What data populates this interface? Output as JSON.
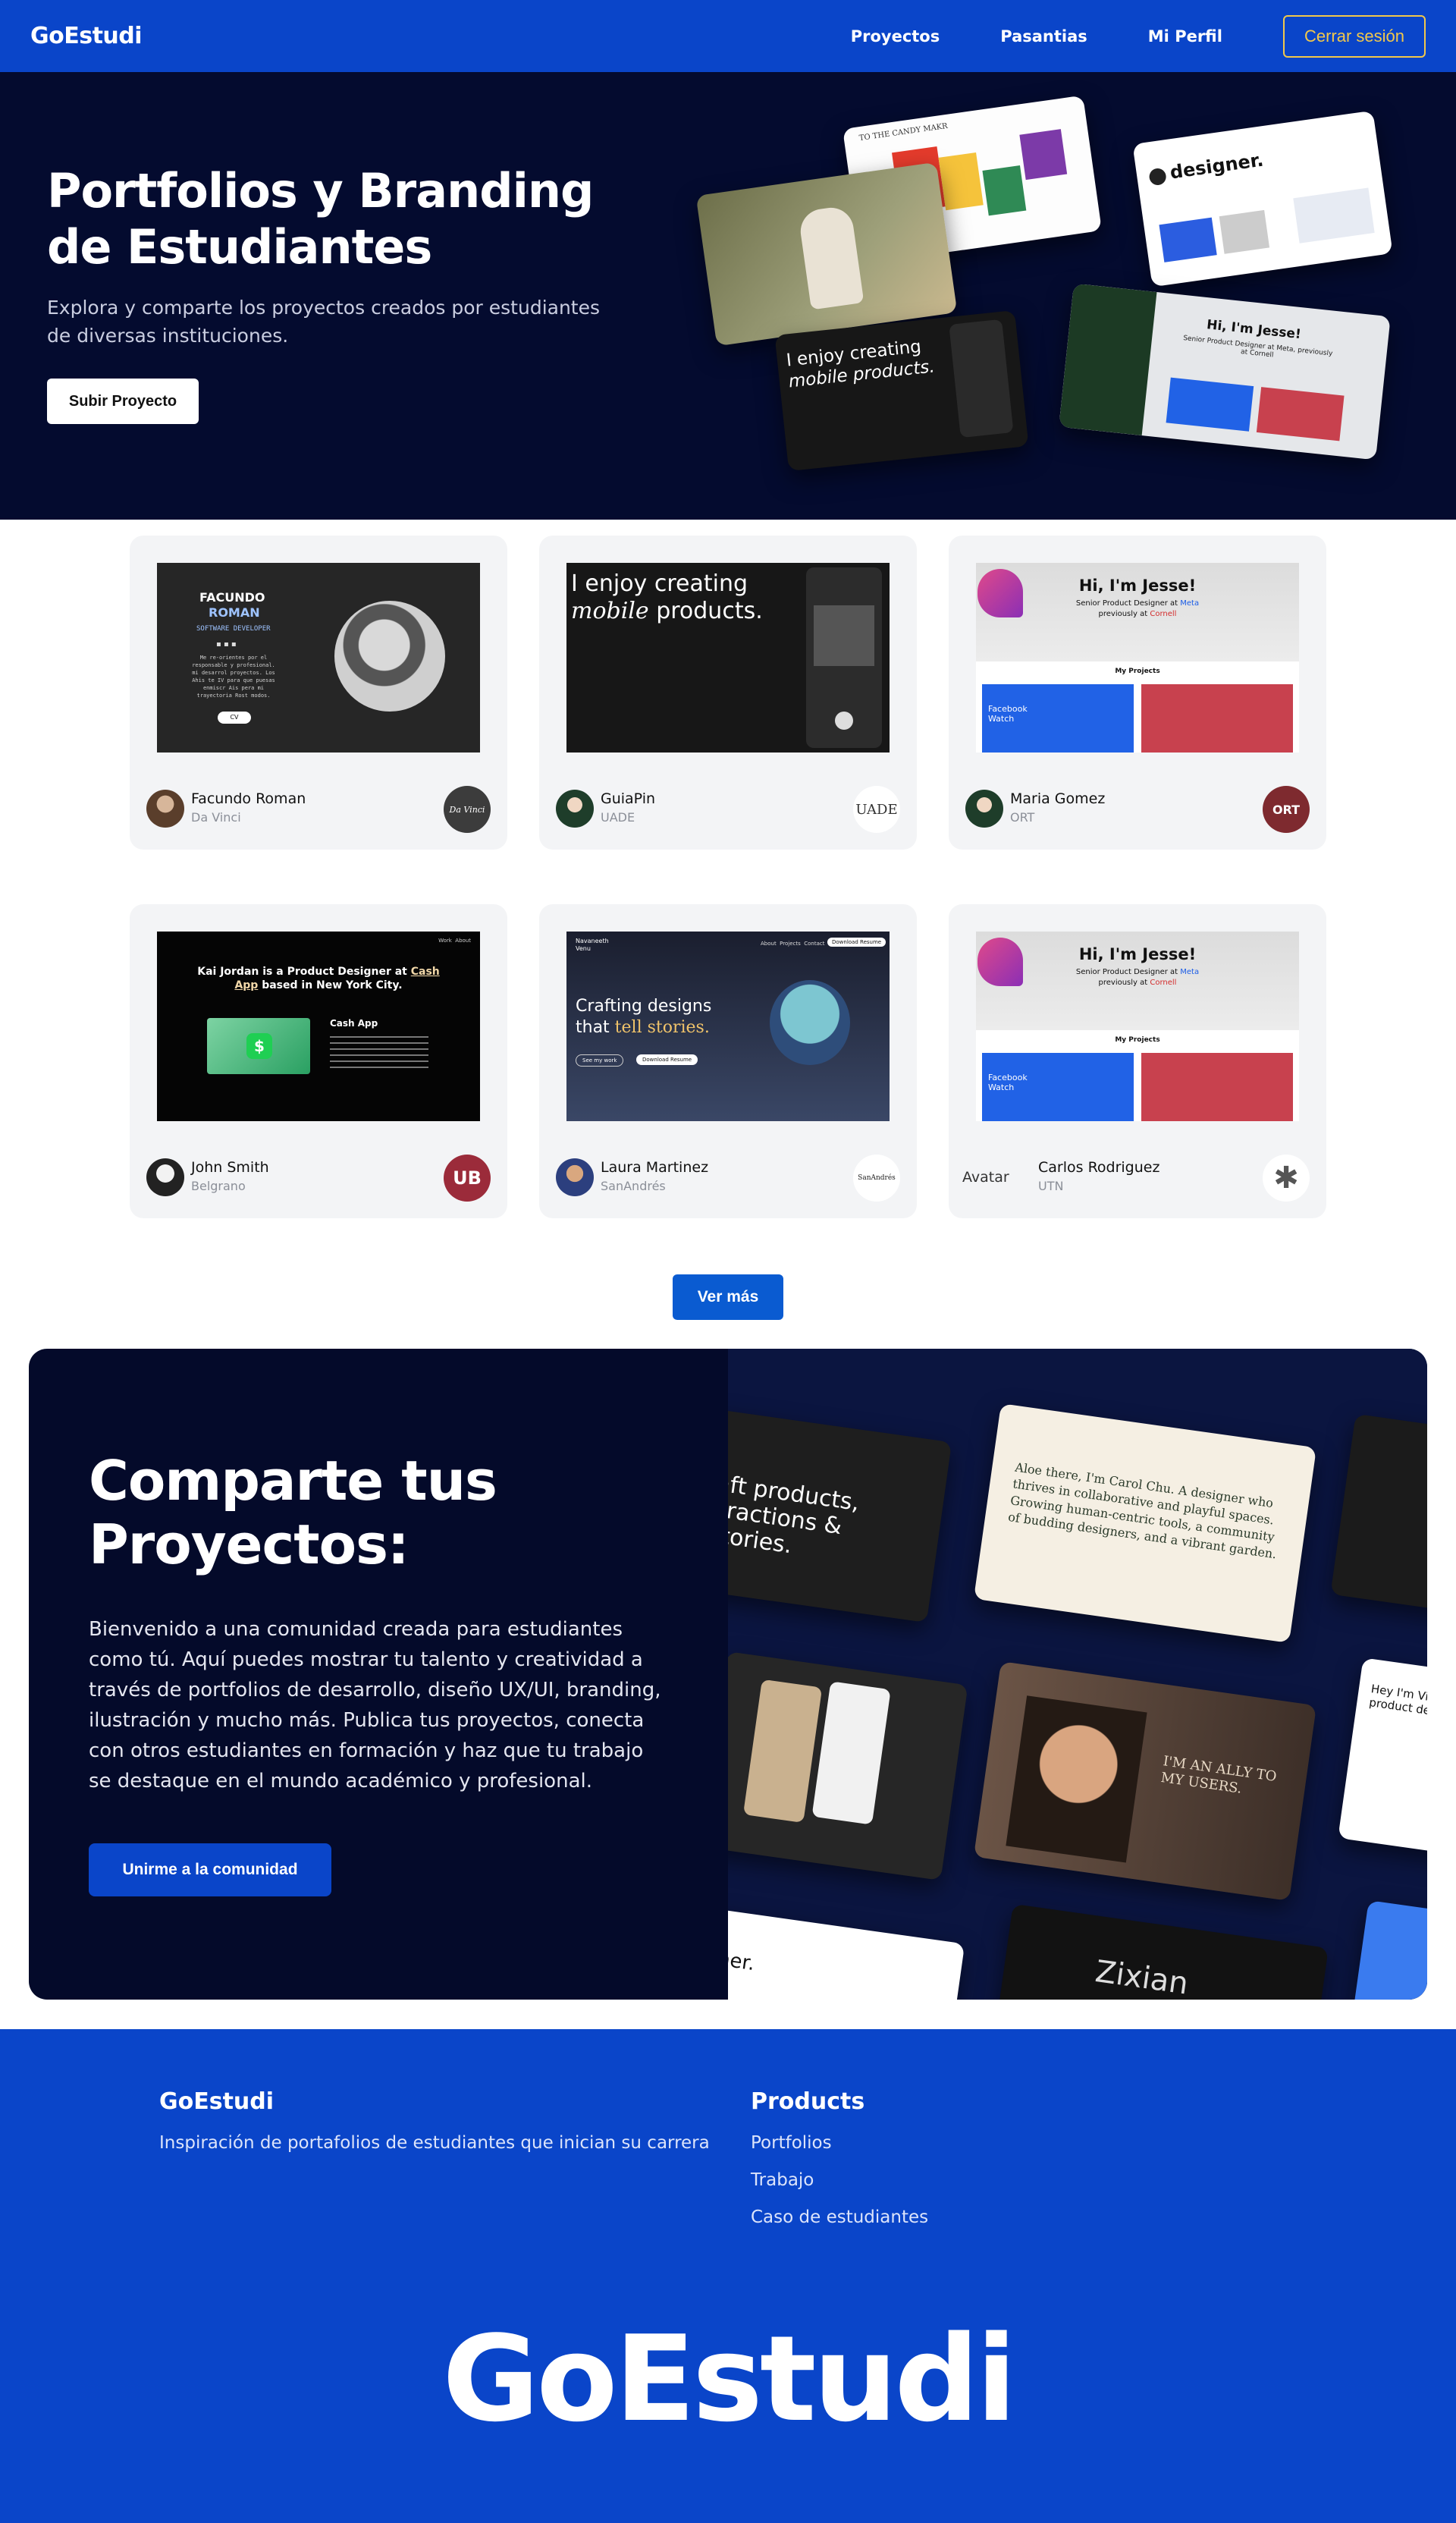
{
  "nav": {
    "brand": "GoEstudi",
    "links": [
      "Proyectos",
      "Pasantias",
      "Mi Perfil"
    ],
    "logout_label": "Cerrar sesión"
  },
  "hero": {
    "title": "Portfolios y Branding de Estudiantes",
    "subtitle": "Explora y comparte los proyectos creados por estudiantes de diversas instituciones.",
    "upload_label": "Subir Proyecto",
    "collage": {
      "candy_title": "TO THE CANDY MAKR",
      "designer": "designer.",
      "mobile_line1": "I enjoy creating",
      "mobile_line2": "mobile products.",
      "jesse_title": "Hi, I'm Jesse!",
      "jesse_role": "Senior Product Designer at Meta, previously at Cornell"
    }
  },
  "projects": [
    {
      "name": "Facundo Roman",
      "institution": "Da Vinci",
      "logo_text": "Da Vinci",
      "thumb": {
        "title_line1": "FACUNDO",
        "title_line2": "ROMAN",
        "role": "SOFTWARE DEVELOPER",
        "desc": "Me re-orientes por el responsable y profesional. mi desarrol proyectos. Los Ahis te IV para que puesas enmiscr Ais pera mi trayectoria Rost modos.",
        "cv": "CV"
      }
    },
    {
      "name": "GuiaPin",
      "institution": "UADE",
      "logo_text": "UADE",
      "thumb": {
        "line1": "I enjoy creating",
        "line2_italic": "mobile",
        "line2_rest": " products."
      }
    },
    {
      "name": "Maria Gomez",
      "institution": "ORT",
      "logo_text": "ORT",
      "thumb": {
        "title": "Hi, I'm Jesse!",
        "role_prefix": "Senior Product Designer at ",
        "role_company": "Meta",
        "previously": "previously at ",
        "prev_company": "Cornell",
        "projects_label": "My Projects",
        "watch_label": "Facebook Watch"
      }
    },
    {
      "name": "John Smith",
      "institution": "Belgrano",
      "logo_text": "UB",
      "thumb": {
        "headline_a": "Kai Jordan is a Product Designer at ",
        "headline_link": "Cash App",
        "headline_b": " based in New York City.",
        "project": "Cash App",
        "nav1": "Work",
        "nav2": "About"
      }
    },
    {
      "name": "Laura Martinez",
      "institution": "SanAndrés",
      "logo_text": "SanAndrés",
      "thumb": {
        "brand_line1": "Navaneeth",
        "brand_line2": "Venu",
        "menu": [
          "About",
          "Projects",
          "Contact"
        ],
        "resume_btn": "Download Resume",
        "headline_a": "Crafting designs",
        "headline_b": "that ",
        "headline_em": "tell stories.",
        "see_work": "See my work",
        "download": "Download Resume"
      }
    },
    {
      "name": "Carlos Rodriguez",
      "institution": "UTN",
      "logo_text": "✱",
      "avatar_alt": "Avatar",
      "thumb": {
        "title": "Hi, I'm Jesse!",
        "role_prefix": "Senior Product Designer at ",
        "role_company": "Meta",
        "previously": "previously at ",
        "prev_company": "Cornell",
        "projects_label": "My Projects",
        "watch_label": "Facebook Watch"
      }
    }
  ],
  "more_label": "Ver más",
  "community": {
    "title": "Comparte tus Proyectos:",
    "body": "Bienvenido a una comunidad creada para estudiantes como tú. Aquí puedes mostrar tu talento y creatividad a través de portfolios de desarrollo, diseño UX/UI, branding, ilustración y mucho más. Publica tus proyectos, conecta con otros estudiantes en formación y haz que tu trabajo se destaque en el mundo académico y profesional.",
    "join_label": "Unirme a la comunidad",
    "gallery": {
      "craft": "aft products, eractions & stories.",
      "carol": "Aloe there, I'm Carol Chu. A designer who thrives in collaborative and playful spaces. Growing human-centric tools, a community of budding designers, and a vibrant garden.",
      "victor": "Hey I'm Victor, a product designer",
      "ally": "I'M AN ALLY TO MY USERS.",
      "zixian": "Zixian",
      "partial": "ner."
    }
  },
  "footer": {
    "brand": "GoEstudi",
    "tagline": "Inspiración de portafolios de estudiantes que inician su carrera",
    "products_title": "Products",
    "products": [
      "Portfolios",
      "Trabajo",
      "Caso de estudiantes"
    ],
    "big_brand": "GoEstudi"
  },
  "colors": {
    "primary_blue": "#0a45c9",
    "hero_navy": "#040b2f",
    "logout_gold": "#f2c84b",
    "card_bg": "#f3f4f6",
    "button_blue": "#0a5bd1"
  }
}
